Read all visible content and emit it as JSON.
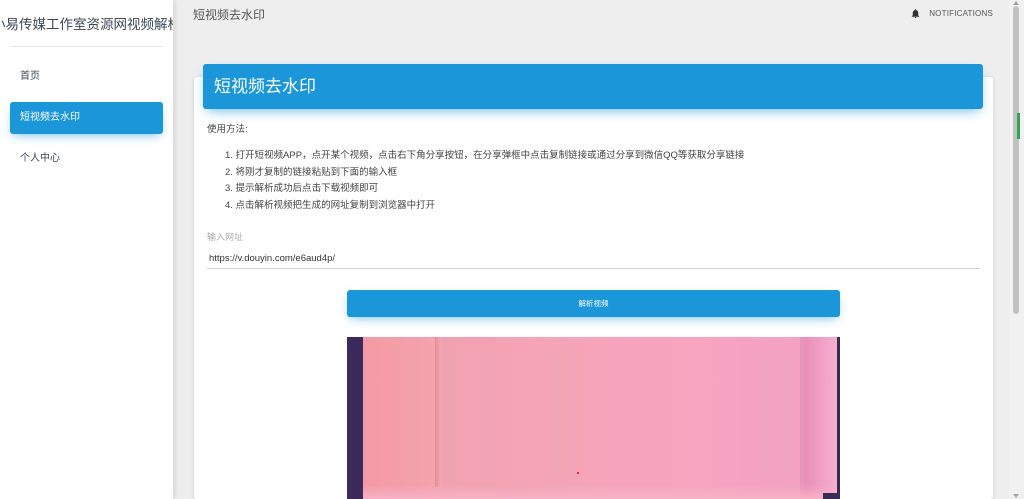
{
  "sidebar": {
    "brand": "小易传媒工作室资源网视频解析",
    "items": [
      {
        "label": "首页",
        "active": false
      },
      {
        "label": "短视频去水印",
        "active": true
      },
      {
        "label": "个人中心",
        "active": false
      }
    ]
  },
  "topbar": {
    "title": "短视频去水印",
    "notifications_label": "NOTIFICATIONS",
    "notifications_icon": "bell-icon"
  },
  "card": {
    "header": "短视频去水印",
    "usage_title": "使用方法:",
    "steps": [
      "1. 打开短视频APP，点开某个视频，点击右下角分享按钮，在分享弹框中点击复制链接或通过分享到微信QQ等获取分享链接",
      "2. 将刚才复制的链接粘贴到下面的输入框",
      "3. 提示解析成功后点击下载视频即可",
      "4. 点击解析视频把生成的网址复制到浏览器中打开"
    ],
    "input_label": "输入网址",
    "input_value": "https://v.douyin.com/e6aud4p/",
    "parse_button": "解析视频"
  },
  "colors": {
    "accent": "#1b96d9",
    "background": "#eeeeee",
    "sidebar": "#ffffff"
  }
}
